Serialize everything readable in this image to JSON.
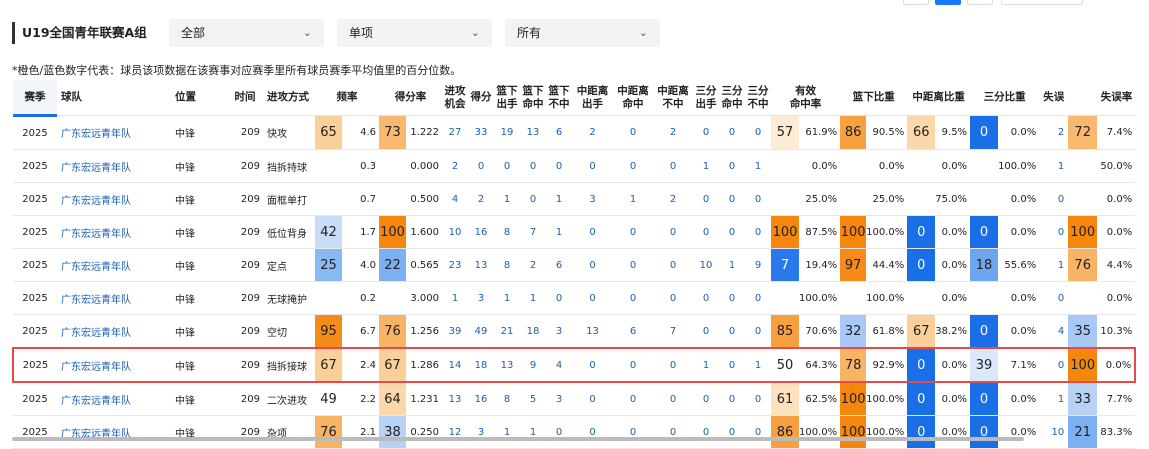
{
  "header": {
    "title": "U19全国青年联赛A组",
    "filters": [
      {
        "value": "全部"
      },
      {
        "value": "单项"
      },
      {
        "value": "所有"
      }
    ],
    "note": "*橙色/蓝色数字代表：球员该项数据在该赛事对应赛季里所有球员赛季平均值里的百分位数。"
  },
  "columns": [
    "赛季",
    "球队",
    "位置",
    "时间",
    "进攻方式",
    "频率",
    "",
    "得分率",
    "",
    "进攻机会",
    "得分",
    "篮下出手",
    "篮下命中",
    "篮下不中",
    "中距离出手",
    "中距离命中",
    "中距离不中",
    "三分出手",
    "三分命中",
    "三分不中",
    "有效命中率",
    "",
    "篮下比重",
    "",
    "中距离比重",
    "",
    "三分比重",
    "",
    "失误",
    "失误率"
  ],
  "colors": {
    "orange_high": "#f5870f",
    "orange_mid": "#f9b870",
    "orange_low": "#fde3c4",
    "blue_high": "#1a6fe6",
    "blue_mid": "#6ca6f0",
    "blue_low": "#c8dcf7",
    "highlight_border": "#e84a4a",
    "link": "#1a5fb4"
  },
  "rows": [
    {
      "season": "2025",
      "team": "广东宏远青年队",
      "pos": "中锋",
      "time": "209",
      "type": "快攻",
      "freq_p": "65",
      "freq_p_color": "#fbcf9a",
      "freq": "4.6",
      "ppp_p": "73",
      "ppp_p_color": "#f9b870",
      "ppp": "1.222",
      "poss": "27",
      "pts": "33",
      "rim_a": "19",
      "rim_m": "13",
      "rim_x": "6",
      "mid_a": "2",
      "mid_m": "0",
      "mid_x": "2",
      "tp_a": "0",
      "tp_m": "0",
      "tp_x": "0",
      "efg_p": "57",
      "efg_p_color": "#fdebd4",
      "efg": "61.9%",
      "rim_r_p": "86",
      "rim_r_p_color": "#f6a040",
      "rim_r": "90.5%",
      "mid_r_p": "66",
      "mid_r_p_color": "#fcd7aa",
      "mid_r": "9.5%",
      "tp_r_p": "0",
      "tp_r_p_color": "#1a6fe6",
      "tp_r": "0.0%",
      "tov": "2",
      "tov_p": "72",
      "tov_p_color": "#f9b870",
      "tov_r": "7.4%",
      "highlight": false
    },
    {
      "season": "2025",
      "team": "广东宏远青年队",
      "pos": "中锋",
      "time": "209",
      "type": "挡拆持球",
      "freq_p": "",
      "freq_p_color": "",
      "freq": "0.3",
      "ppp_p": "",
      "ppp_p_color": "",
      "ppp": "0.000",
      "poss": "2",
      "pts": "0",
      "rim_a": "0",
      "rim_m": "0",
      "rim_x": "0",
      "mid_a": "0",
      "mid_m": "0",
      "mid_x": "0",
      "tp_a": "1",
      "tp_m": "0",
      "tp_x": "1",
      "efg_p": "",
      "efg_p_color": "",
      "efg": "0.0%",
      "rim_r_p": "",
      "rim_r_p_color": "",
      "rim_r": "0.0%",
      "mid_r_p": "",
      "mid_r_p_color": "",
      "mid_r": "0.0%",
      "tp_r_p": "",
      "tp_r_p_color": "",
      "tp_r": "100.0%",
      "tov": "1",
      "tov_p": "",
      "tov_p_color": "",
      "tov_r": "50.0%",
      "highlight": false
    },
    {
      "season": "2025",
      "team": "广东宏远青年队",
      "pos": "中锋",
      "time": "209",
      "type": "面框单打",
      "freq_p": "",
      "freq_p_color": "",
      "freq": "0.7",
      "ppp_p": "",
      "ppp_p_color": "",
      "ppp": "0.500",
      "poss": "4",
      "pts": "2",
      "rim_a": "1",
      "rim_m": "0",
      "rim_x": "1",
      "mid_a": "3",
      "mid_m": "1",
      "mid_x": "2",
      "tp_a": "0",
      "tp_m": "0",
      "tp_x": "0",
      "efg_p": "",
      "efg_p_color": "",
      "efg": "25.0%",
      "rim_r_p": "",
      "rim_r_p_color": "",
      "rim_r": "25.0%",
      "mid_r_p": "",
      "mid_r_p_color": "",
      "mid_r": "75.0%",
      "tp_r_p": "",
      "tp_r_p_color": "",
      "tp_r": "0.0%",
      "tov": "0",
      "tov_p": "",
      "tov_p_color": "",
      "tov_r": "0.0%",
      "highlight": false
    },
    {
      "season": "2025",
      "team": "广东宏远青年队",
      "pos": "中锋",
      "time": "209",
      "type": "低位背身",
      "freq_p": "42",
      "freq_p_color": "#c8dcf7",
      "freq": "1.7",
      "ppp_p": "100",
      "ppp_p_color": "#f5870f",
      "ppp": "1.600",
      "poss": "10",
      "pts": "16",
      "rim_a": "8",
      "rim_m": "7",
      "rim_x": "1",
      "mid_a": "0",
      "mid_m": "0",
      "mid_x": "0",
      "tp_a": "0",
      "tp_m": "0",
      "tp_x": "0",
      "efg_p": "100",
      "efg_p_color": "#f5870f",
      "efg": "87.5%",
      "rim_r_p": "100",
      "rim_r_p_color": "#f5870f",
      "rim_r": "100.0%",
      "mid_r_p": "0",
      "mid_r_p_color": "#1a6fe6",
      "mid_r": "0.0%",
      "tp_r_p": "0",
      "tp_r_p_color": "#1a6fe6",
      "tp_r": "0.0%",
      "tov": "0",
      "tov_p": "100",
      "tov_p_color": "#f5870f",
      "tov_r": "0.0%",
      "highlight": false
    },
    {
      "season": "2025",
      "team": "广东宏远青年队",
      "pos": "中锋",
      "time": "209",
      "type": "定点",
      "freq_p": "25",
      "freq_p_color": "#8ab8f2",
      "freq": "4.0",
      "ppp_p": "22",
      "ppp_p_color": "#7cb0f1",
      "ppp": "0.565",
      "poss": "23",
      "pts": "13",
      "rim_a": "8",
      "rim_m": "2",
      "rim_x": "6",
      "mid_a": "0",
      "mid_m": "0",
      "mid_x": "0",
      "tp_a": "10",
      "tp_m": "1",
      "tp_x": "9",
      "efg_p": "7",
      "efg_p_color": "#2a79ea",
      "efg": "19.4%",
      "rim_r_p": "97",
      "rim_r_p_color": "#f58b18",
      "rim_r": "44.4%",
      "mid_r_p": "0",
      "mid_r_p_color": "#1a6fe6",
      "mid_r": "0.0%",
      "tp_r_p": "18",
      "tp_r_p_color": "#6ca6f0",
      "tp_r": "55.6%",
      "tov": "1",
      "tov_p": "76",
      "tov_p_color": "#f8b465",
      "tov_r": "4.4%",
      "highlight": false
    },
    {
      "season": "2025",
      "team": "广东宏远青年队",
      "pos": "中锋",
      "time": "209",
      "type": "无球掩护",
      "freq_p": "",
      "freq_p_color": "",
      "freq": "0.2",
      "ppp_p": "",
      "ppp_p_color": "",
      "ppp": "3.000",
      "poss": "1",
      "pts": "3",
      "rim_a": "1",
      "rim_m": "1",
      "rim_x": "0",
      "mid_a": "0",
      "mid_m": "0",
      "mid_x": "0",
      "tp_a": "0",
      "tp_m": "0",
      "tp_x": "0",
      "efg_p": "",
      "efg_p_color": "",
      "efg": "100.0%",
      "rim_r_p": "",
      "rim_r_p_color": "",
      "rim_r": "100.0%",
      "mid_r_p": "",
      "mid_r_p_color": "",
      "mid_r": "0.0%",
      "tp_r_p": "",
      "tp_r_p_color": "",
      "tp_r": "0.0%",
      "tov": "0",
      "tov_p": "",
      "tov_p_color": "",
      "tov_r": "0.0%",
      "highlight": false
    },
    {
      "season": "2025",
      "team": "广东宏远青年队",
      "pos": "中锋",
      "time": "209",
      "type": "空切",
      "freq_p": "95",
      "freq_p_color": "#f58b18",
      "freq": "6.7",
      "ppp_p": "76",
      "ppp_p_color": "#f8b465",
      "ppp": "1.256",
      "poss": "39",
      "pts": "49",
      "rim_a": "21",
      "rim_m": "18",
      "rim_x": "3",
      "mid_a": "13",
      "mid_m": "6",
      "mid_x": "7",
      "tp_a": "0",
      "tp_m": "0",
      "tp_x": "0",
      "efg_p": "85",
      "efg_p_color": "#f6a040",
      "efg": "70.6%",
      "rim_r_p": "32",
      "rim_r_p_color": "#a8c8f5",
      "rim_r": "61.8%",
      "mid_r_p": "67",
      "mid_r_p_color": "#fbcf9a",
      "mid_r": "38.2%",
      "tp_r_p": "0",
      "tp_r_p_color": "#1a6fe6",
      "tp_r": "0.0%",
      "tov": "4",
      "tov_p": "35",
      "tov_p_color": "#a8c8f5",
      "tov_r": "10.3%",
      "highlight": false
    },
    {
      "season": "2025",
      "team": "广东宏远青年队",
      "pos": "中锋",
      "time": "209",
      "type": "挡拆接球",
      "freq_p": "67",
      "freq_p_color": "#fbcf9a",
      "freq": "2.4",
      "ppp_p": "67",
      "ppp_p_color": "#fbcf9a",
      "ppp": "1.286",
      "poss": "14",
      "pts": "18",
      "rim_a": "13",
      "rim_m": "9",
      "rim_x": "4",
      "mid_a": "0",
      "mid_m": "0",
      "mid_x": "0",
      "tp_a": "1",
      "tp_m": "0",
      "tp_x": "1",
      "efg_p": "50",
      "efg_p_color": "#ffffff",
      "efg": "64.3%",
      "rim_r_p": "78",
      "rim_r_p_color": "#f8b465",
      "rim_r": "92.9%",
      "mid_r_p": "0",
      "mid_r_p_color": "#1a6fe6",
      "mid_r": "0.0%",
      "tp_r_p": "39",
      "tp_r_p_color": "#dbe8fa",
      "tp_r": "7.1%",
      "tov": "0",
      "tov_p": "100",
      "tov_p_color": "#f5870f",
      "tov_r": "0.0%",
      "highlight": true
    },
    {
      "season": "2025",
      "team": "广东宏远青年队",
      "pos": "中锋",
      "time": "209",
      "type": "二次进攻",
      "freq_p": "49",
      "freq_p_color": "#ffffff",
      "freq": "2.2",
      "ppp_p": "64",
      "ppp_p_color": "#fcd7aa",
      "ppp": "1.231",
      "poss": "13",
      "pts": "16",
      "rim_a": "8",
      "rim_m": "5",
      "rim_x": "3",
      "mid_a": "0",
      "mid_m": "0",
      "mid_x": "0",
      "tp_a": "0",
      "tp_m": "0",
      "tp_x": "0",
      "efg_p": "61",
      "efg_p_color": "#fde0bd",
      "efg": "62.5%",
      "rim_r_p": "100",
      "rim_r_p_color": "#f5870f",
      "rim_r": "100.0%",
      "mid_r_p": "0",
      "mid_r_p_color": "#1a6fe6",
      "mid_r": "0.0%",
      "tp_r_p": "0",
      "tp_r_p_color": "#1a6fe6",
      "tp_r": "0.0%",
      "tov": "1",
      "tov_p": "33",
      "tov_p_color": "#b8d2f5",
      "tov_r": "7.7%",
      "highlight": false
    },
    {
      "season": "2025",
      "team": "广东宏远青年队",
      "pos": "中锋",
      "time": "209",
      "type": "杂项",
      "freq_p": "76",
      "freq_p_color": "#f8b465",
      "freq": "2.1",
      "ppp_p": "38",
      "ppp_p_color": "#b8d2f5",
      "ppp": "0.250",
      "poss": "12",
      "pts": "3",
      "rim_a": "1",
      "rim_m": "1",
      "rim_x": "0",
      "mid_a": "0",
      "mid_m": "0",
      "mid_x": "0",
      "tp_a": "0",
      "tp_m": "0",
      "tp_x": "0",
      "efg_p": "86",
      "efg_p_color": "#f6a040",
      "efg": "100.0%",
      "rim_r_p": "100",
      "rim_r_p_color": "#f5870f",
      "rim_r": "100.0%",
      "mid_r_p": "0",
      "mid_r_p_color": "#1a6fe6",
      "mid_r": "0.0%",
      "tp_r_p": "0",
      "tp_r_p_color": "#1a6fe6",
      "tp_r": "0.0%",
      "tov": "10",
      "tov_p": "21",
      "tov_p_color": "#7cb0f1",
      "tov_r": "83.3%",
      "highlight": false
    }
  ]
}
